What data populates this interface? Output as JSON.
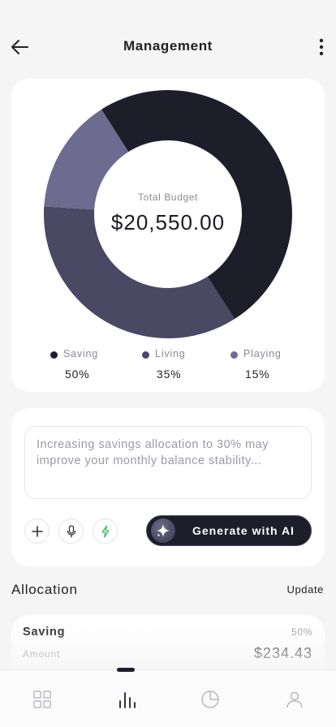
{
  "header": {
    "title": "Management"
  },
  "budget": {
    "label": "Total Budget",
    "value": "$20,550.00"
  },
  "chart_data": {
    "type": "pie",
    "categories": [
      "Saving",
      "Living",
      "Playing"
    ],
    "values": [
      50,
      35,
      15
    ],
    "colors": [
      "#1e1d2a",
      "#4a4862",
      "#6d6b8f"
    ],
    "legend_placement": "bottom"
  },
  "legend": [
    {
      "name": "Saving",
      "percent": "50%",
      "color": "#1e1d2a"
    },
    {
      "name": "Living",
      "percent": "35%",
      "color": "#4a4862"
    },
    {
      "name": "Playing",
      "percent": "15%",
      "color": "#6d6b8f"
    }
  ],
  "ai": {
    "prompt": "Increasing savings allocation to 30% may improve your monthly balance stability...",
    "generate_label": "Generate with AI"
  },
  "allocation": {
    "section_title": "Allocation",
    "update_label": "Update",
    "items": [
      {
        "name": "Saving",
        "percent": "50%",
        "amount_label": "Amount",
        "amount": "$234.43"
      }
    ]
  },
  "colors": {
    "background": "#f5f5f6",
    "card": "#ffffff",
    "accent_dark": "#1e1d2a",
    "bolt_green": "#3bbf5f"
  },
  "tabs": [
    {
      "icon": "grid-icon",
      "active": false
    },
    {
      "icon": "bar-chart-icon",
      "active": true
    },
    {
      "icon": "pie-chart-icon",
      "active": false
    },
    {
      "icon": "profile-icon",
      "active": false
    }
  ]
}
